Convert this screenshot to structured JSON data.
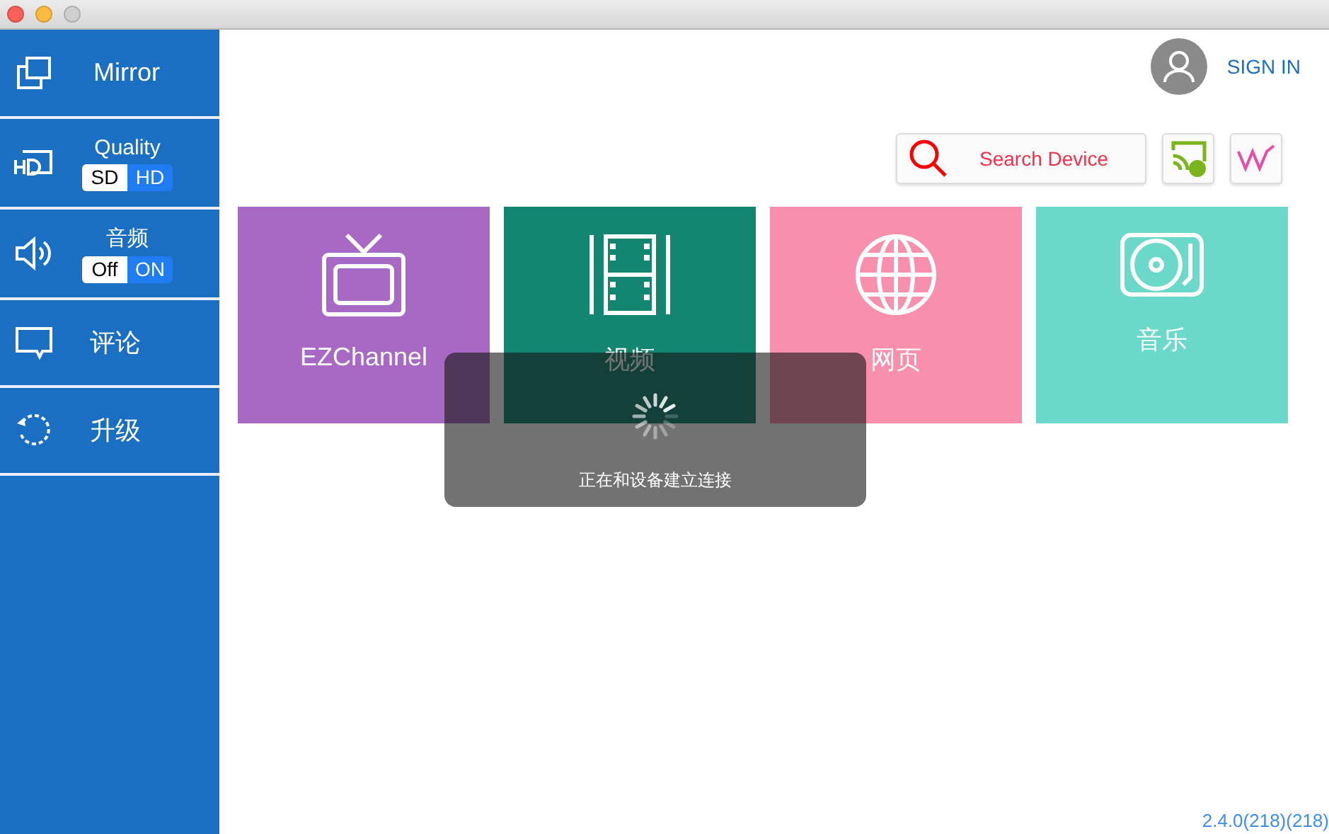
{
  "sidebar": {
    "items": [
      {
        "kind": "link",
        "label": "Mirror"
      },
      {
        "kind": "toggle",
        "label": "Quality",
        "options": [
          {
            "label": "SD",
            "selected": false
          },
          {
            "label": "HD",
            "selected": true
          }
        ]
      },
      {
        "kind": "toggle",
        "label": "音频",
        "options": [
          {
            "label": "Off",
            "selected": false
          },
          {
            "label": "ON",
            "selected": true
          }
        ]
      },
      {
        "kind": "link",
        "label": "评论"
      },
      {
        "kind": "link",
        "label": "升级"
      }
    ]
  },
  "header": {
    "sign_in": "SIGN IN",
    "search_button": "Search Device"
  },
  "tiles": [
    {
      "label": "EZChannel",
      "color": "#a869c5"
    },
    {
      "label": "视频",
      "color": "#138672"
    },
    {
      "label": "网页",
      "color": "#f78fad"
    },
    {
      "label": "音乐",
      "color": "#6ad9c9"
    }
  ],
  "loading": {
    "message": "正在和设备建立连接"
  },
  "version": "2.4.0(218)(218)"
}
